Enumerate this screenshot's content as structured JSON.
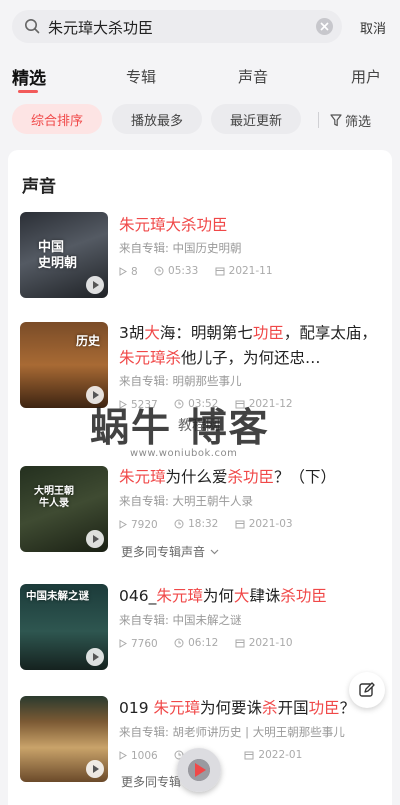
{
  "search": {
    "query": "朱元璋大杀功臣",
    "cancel_label": "取消"
  },
  "tabs": [
    {
      "label": "精选",
      "active": true
    },
    {
      "label": "专辑",
      "active": false
    },
    {
      "label": "声音",
      "active": false
    },
    {
      "label": "用户",
      "active": false
    }
  ],
  "filters": {
    "chips": [
      {
        "label": "综合排序",
        "active": true
      },
      {
        "label": "播放最多",
        "active": false
      },
      {
        "label": "最近更新",
        "active": false
      }
    ],
    "filter_label": "筛选"
  },
  "section": {
    "title": "声音"
  },
  "results": [
    {
      "title_parts": [
        {
          "t": "朱元璋大杀功臣",
          "h": true
        }
      ],
      "album": "来自专辑: 中国历史明朝",
      "plays": "8",
      "duration": "05:33",
      "date": "2021-11",
      "cover_text": "中国\n史明朝"
    },
    {
      "title_parts": [
        {
          "t": "3胡",
          "h": false
        },
        {
          "t": "大",
          "h": true
        },
        {
          "t": "海：明朝第七",
          "h": false
        },
        {
          "t": "功臣",
          "h": true
        },
        {
          "t": "，配享太庙，",
          "h": false
        },
        {
          "t": "朱元璋",
          "h": true
        },
        {
          "t": "杀",
          "h": true
        },
        {
          "t": "他儿子，为何还忠…",
          "h": false
        }
      ],
      "album": "来自专辑: 明朝那些事儿",
      "plays": "5237",
      "duration": "03:52",
      "date": "2021-12",
      "cover_text": "历史"
    },
    {
      "title_parts": [
        {
          "t": "朱元璋",
          "h": true
        },
        {
          "t": "为什么爱",
          "h": false
        },
        {
          "t": "杀功臣",
          "h": true
        },
        {
          "t": "？（下）",
          "h": false
        }
      ],
      "album": "来自专辑: 大明王朝牛人录",
      "plays": "7920",
      "duration": "18:32",
      "date": "2021-03",
      "cover_text": "大明王朝\n牛人录",
      "more": "更多同专辑声音"
    },
    {
      "title_parts": [
        {
          "t": "046_",
          "h": false
        },
        {
          "t": "朱元璋",
          "h": true
        },
        {
          "t": "为何",
          "h": false
        },
        {
          "t": "大",
          "h": true
        },
        {
          "t": "肆诛",
          "h": false
        },
        {
          "t": "杀功臣",
          "h": true
        }
      ],
      "album": "来自专辑: 中国未解之谜",
      "plays": "7760",
      "duration": "06:12",
      "date": "2021-10",
      "cover_text": "中国未解之谜"
    },
    {
      "title_parts": [
        {
          "t": "019 ",
          "h": false
        },
        {
          "t": "朱元璋",
          "h": true
        },
        {
          "t": "为何要诛",
          "h": false
        },
        {
          "t": "杀",
          "h": true
        },
        {
          "t": "开国",
          "h": false
        },
        {
          "t": "功臣",
          "h": true
        },
        {
          "t": "？",
          "h": false
        }
      ],
      "album": "来自专辑: 胡老师讲历史 | 大明王朝那些事儿",
      "plays": "1006",
      "duration": "",
      "date": "2022-01",
      "cover_text": "",
      "more": "更多同专辑"
    }
  ],
  "watermark": {
    "big": "蜗牛 博客",
    "small": "教程网",
    "url": "www.woniubok.com"
  },
  "colors": {
    "accent": "#f04848",
    "chip_active_bg": "#fde4e4",
    "page_bg": "#f4f4f6"
  },
  "icons": [
    "search-icon",
    "clear-icon",
    "filter-icon",
    "play-count-icon",
    "clock-icon",
    "calendar-icon",
    "chevron-down-icon",
    "edit-icon",
    "player-icon"
  ]
}
